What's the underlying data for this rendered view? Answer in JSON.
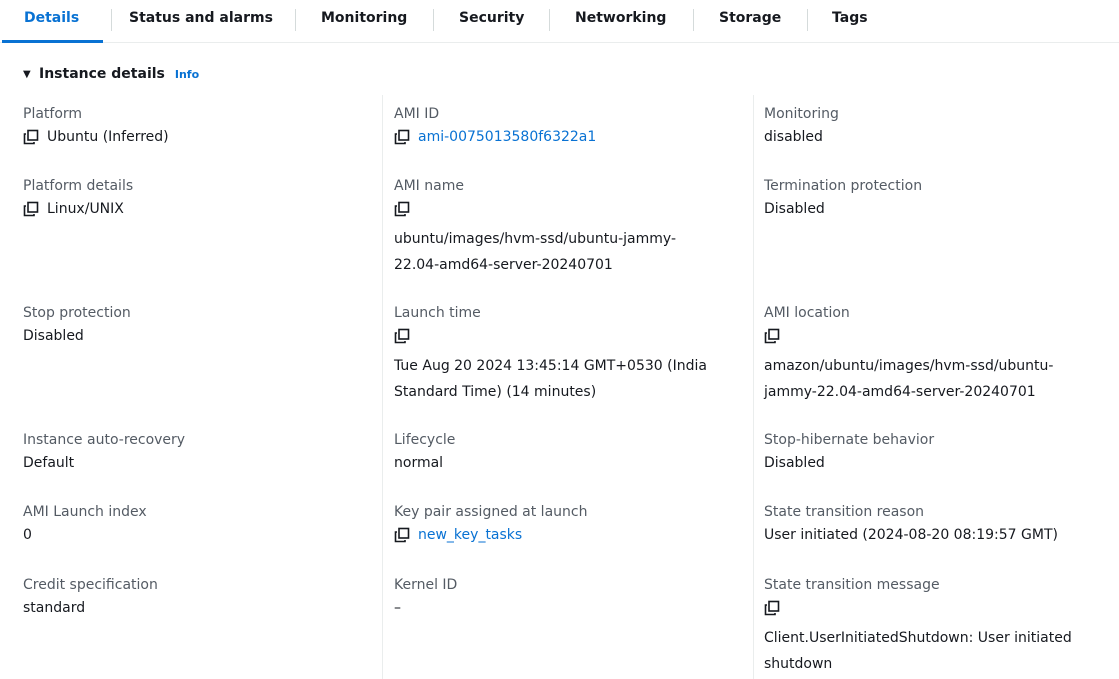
{
  "tabs": [
    {
      "label": "Details",
      "active": true
    },
    {
      "label": "Status and alarms"
    },
    {
      "label": "Monitoring"
    },
    {
      "label": "Security"
    },
    {
      "label": "Networking"
    },
    {
      "label": "Storage"
    },
    {
      "label": "Tags"
    }
  ],
  "section": {
    "title": "Instance details",
    "info": "Info"
  },
  "fields": {
    "platform": {
      "label": "Platform",
      "value": "Ubuntu (Inferred)"
    },
    "platform_details": {
      "label": "Platform details",
      "value": "Linux/UNIX"
    },
    "stop_protection": {
      "label": "Stop protection",
      "value": "Disabled"
    },
    "auto_recovery": {
      "label": "Instance auto-recovery",
      "value": "Default"
    },
    "ami_launch_index": {
      "label": "AMI Launch index",
      "value": "0"
    },
    "credit_spec": {
      "label": "Credit specification",
      "value": "standard"
    },
    "ami_id": {
      "label": "AMI ID",
      "value": "ami-0075013580f6322a1"
    },
    "ami_name": {
      "label": "AMI name",
      "value_line1": "ubuntu/images/hvm-ssd/ubuntu-jammy-",
      "value_line2": "22.04-amd64-server-20240701"
    },
    "launch_time": {
      "label": "Launch time",
      "value_line1": "Tue Aug 20 2024 13:45:14 GMT+0530 (India",
      "value_line2": "Standard Time) (14 minutes)"
    },
    "lifecycle": {
      "label": "Lifecycle",
      "value": "normal"
    },
    "key_pair": {
      "label": "Key pair assigned at launch",
      "value": "new_key_tasks"
    },
    "kernel_id": {
      "label": "Kernel ID",
      "value": "–"
    },
    "monitoring": {
      "label": "Monitoring",
      "value": "disabled"
    },
    "termination_protection": {
      "label": "Termination protection",
      "value": "Disabled"
    },
    "ami_location": {
      "label": "AMI location",
      "value_line1": "amazon/ubuntu/images/hvm-ssd/ubuntu-",
      "value_line2": "jammy-22.04-amd64-server-20240701"
    },
    "stop_hibernate": {
      "label": "Stop-hibernate behavior",
      "value": "Disabled"
    },
    "state_reason": {
      "label": "State transition reason",
      "value": "User initiated (2024-08-20 08:19:57 GMT)"
    },
    "state_message": {
      "label": "State transition message",
      "value_line1": "Client.UserInitiatedShutdown: User initiated",
      "value_line2": "shutdown"
    }
  },
  "icons": {
    "copy": "copy-icon",
    "caret": "caret-down-icon"
  },
  "colors": {
    "link": "#0972d3",
    "label": "#545b64",
    "text": "#16191f"
  }
}
